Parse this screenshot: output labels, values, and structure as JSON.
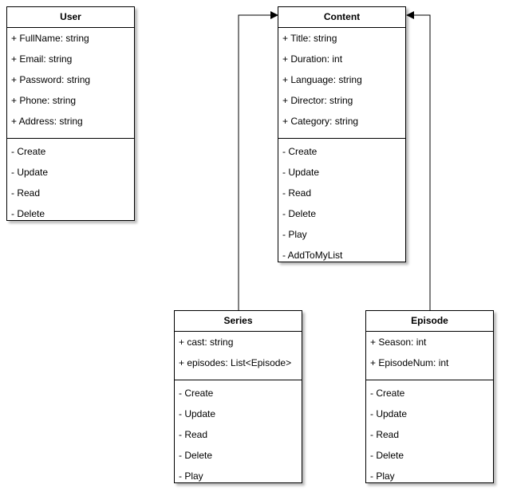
{
  "diagram": {
    "classes": {
      "user": {
        "name": "User",
        "attributes": [
          "+ FullName: string",
          "+ Email: string",
          "+ Password: string",
          "+ Phone: string",
          "+ Address: string"
        ],
        "methods": [
          "- Create",
          "- Update",
          "- Read",
          "- Delete"
        ]
      },
      "content": {
        "name": "Content",
        "attributes": [
          "+ Title: string",
          "+ Duration: int",
          "+ Language: string",
          "+ Director: string",
          "+ Category: string"
        ],
        "methods": [
          "- Create",
          "- Update",
          "- Read",
          "- Delete",
          "- Play",
          "- AddToMyList"
        ]
      },
      "series": {
        "name": "Series",
        "attributes": [
          "+ cast: string",
          "+ episodes: List<Episode>"
        ],
        "methods": [
          "- Create",
          "- Update",
          "- Read",
          "- Delete",
          "- Play"
        ]
      },
      "episode": {
        "name": "Episode",
        "attributes": [
          "+ Season: int",
          "+ EpisodeNum: int"
        ],
        "methods": [
          "- Create",
          "- Update",
          "- Read",
          "- Delete",
          "- Play"
        ]
      }
    },
    "relationships": [
      {
        "from": "series",
        "to": "content",
        "type": "association-arrow"
      },
      {
        "from": "episode",
        "to": "content",
        "type": "association-arrow"
      }
    ],
    "colors": {
      "stroke": "#000000",
      "fill": "#ffffff"
    }
  }
}
